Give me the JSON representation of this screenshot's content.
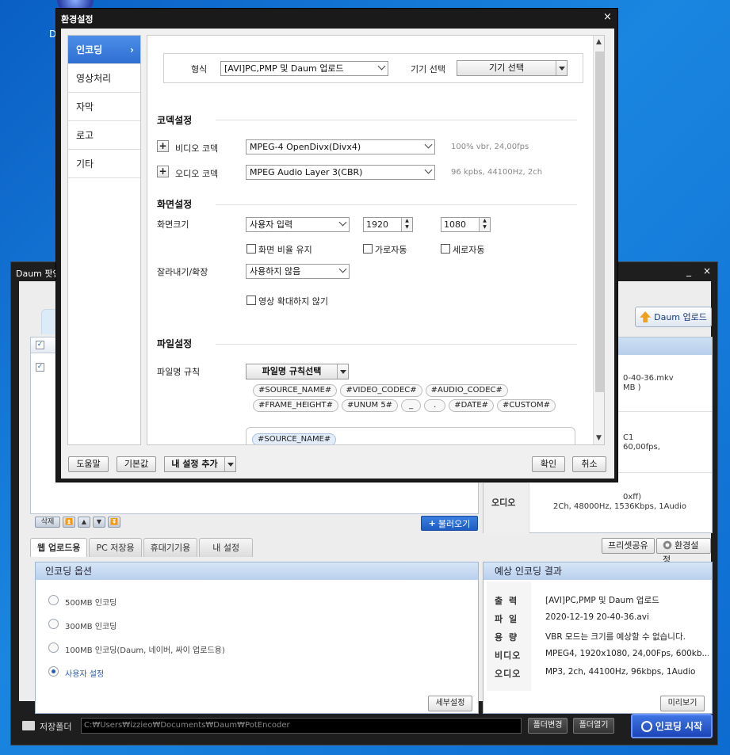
{
  "desktop": {
    "icon_label": "D"
  },
  "encoder": {
    "title": "Daum 팟인",
    "minimize": "_",
    "close": "×",
    "upload_button": "Daum 업로드",
    "info_rows": [
      [
        "0-40-36.mkv",
        "MB )"
      ],
      [
        "C1",
        "60,00fps,"
      ],
      [
        "0xff)",
        "2Ch, 48000Hz, 1536Kbps, 1Audio"
      ]
    ],
    "info_label_3": "오디오",
    "list_btns": [
      "삭제",
      "⏫",
      "▲",
      "▼",
      "⏬"
    ],
    "load_button": "불러오기",
    "tabs": [
      "웹 업로드용",
      "PC 저장용",
      "휴대기기용",
      "내 설정"
    ],
    "preset_share": "프리셋공유",
    "settings_button": "환경설정",
    "options": {
      "title": "인코딩 옵션",
      "items": [
        "500MB 인코딩",
        "300MB 인코딩",
        "100MB 인코딩(Daum, 네이버, 싸이 업로드용)",
        "사용자 설정"
      ],
      "detail_button": "세부설정"
    },
    "result": {
      "title": "예상 인코딩 결과",
      "keys": [
        "출 력",
        "파 일",
        "용 량",
        "비디오",
        "오디오"
      ],
      "values": [
        "[AVI]PC,PMP 및 Daum 업로드",
        "2020-12-19 20-40-36.avi",
        "VBR 모드는 크기를 예상할 수 없습니다.",
        "MPEG4, 1920x1080, 24,00Fps, 600kb...",
        "MP3, 2ch, 44100Hz, 96kbps, 1Audio"
      ],
      "preview_button": "미리보기"
    },
    "folder_label": "저장폴더",
    "path": "C:₩Users₩izzieo₩Documents₩Daum₩PotEncoder",
    "change_folder": "폴더변경",
    "open_folder": "폴더열기",
    "start_button": "인코딩 시작"
  },
  "dialog": {
    "title": "환경설정",
    "close": "×",
    "side": [
      "인코딩",
      "영상처리",
      "자막",
      "로고",
      "기타"
    ],
    "side_chevron": "›",
    "format_label": "형식",
    "format_value": "[AVI]PC,PMP 및 Daum 업로드",
    "device_label": "기기 선택",
    "device_button": "기기 선택",
    "codec_section": "코덱설정",
    "video_codec_label": "비디오 코덱",
    "video_codec_value": "MPEG-4 OpenDivx(Divx4)",
    "video_codec_hint": "100% vbr, 24,00fps",
    "audio_codec_label": "오디오 코덱",
    "audio_codec_value": "MPEG Audio Layer 3(CBR)",
    "audio_codec_hint": "96 kpbs, 44100Hz, 2ch",
    "screen_section": "화면설정",
    "screen_size_label": "화면크기",
    "screen_size_value": "사용자 입력",
    "width": "1920",
    "height": "1080",
    "keep_ratio": "화면 비율 유지",
    "auto_w": "가로자동",
    "auto_h": "세로자동",
    "crop_label": "잘라내기/확장",
    "crop_value": "사용하지 않음",
    "no_zoom": "영상 확대하지 않기",
    "file_section": "파일설정",
    "file_rule_label": "파일명 규칙",
    "file_rule_button": "파일명 규칙선택",
    "tags_row1": [
      "#SOURCE_NAME#",
      "#VIDEO_CODEC#",
      "#AUDIO_CODEC#"
    ],
    "tags_row2": [
      "#FRAME_HEIGHT#",
      "#UNUM 5#",
      "_",
      ".",
      "#DATE#",
      "#CUSTOM#"
    ],
    "rule_tag": "#SOURCE_NAME#",
    "help": "도움말",
    "default": "기본값",
    "add_my": "내 설정 추가",
    "ok": "확인",
    "cancel": "취소"
  }
}
